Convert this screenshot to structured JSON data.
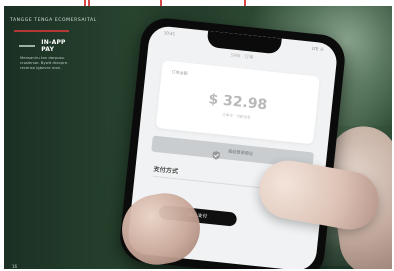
{
  "header": {
    "text": "TANGGE TENGA ECOMERSAITAL"
  },
  "badge": {
    "label": "IN-APP PAY"
  },
  "description": {
    "text": "Mensaniru ton darpuso.\ncrosiersor. Bywit dracpre.\nrecense Igbevra mon."
  },
  "page": {
    "number": "16"
  },
  "phone": {
    "status_left": "10:41",
    "status_right": "LTE ⦿",
    "app_title": "SAN · 订单",
    "card_label": "订单金额",
    "amount": "$ 32.98",
    "amount_sub": "订单号 · 付款信息",
    "verify_label": "指纹登录验证",
    "section_title": "支付方式",
    "pay_button": "确认支付",
    "footnote": "···"
  },
  "colors": {
    "bg_green_dark": "#17291e",
    "accent_red": "#e53a3a",
    "phone_black": "#0b0b0b",
    "screen_bg": "#f1f2f3"
  }
}
